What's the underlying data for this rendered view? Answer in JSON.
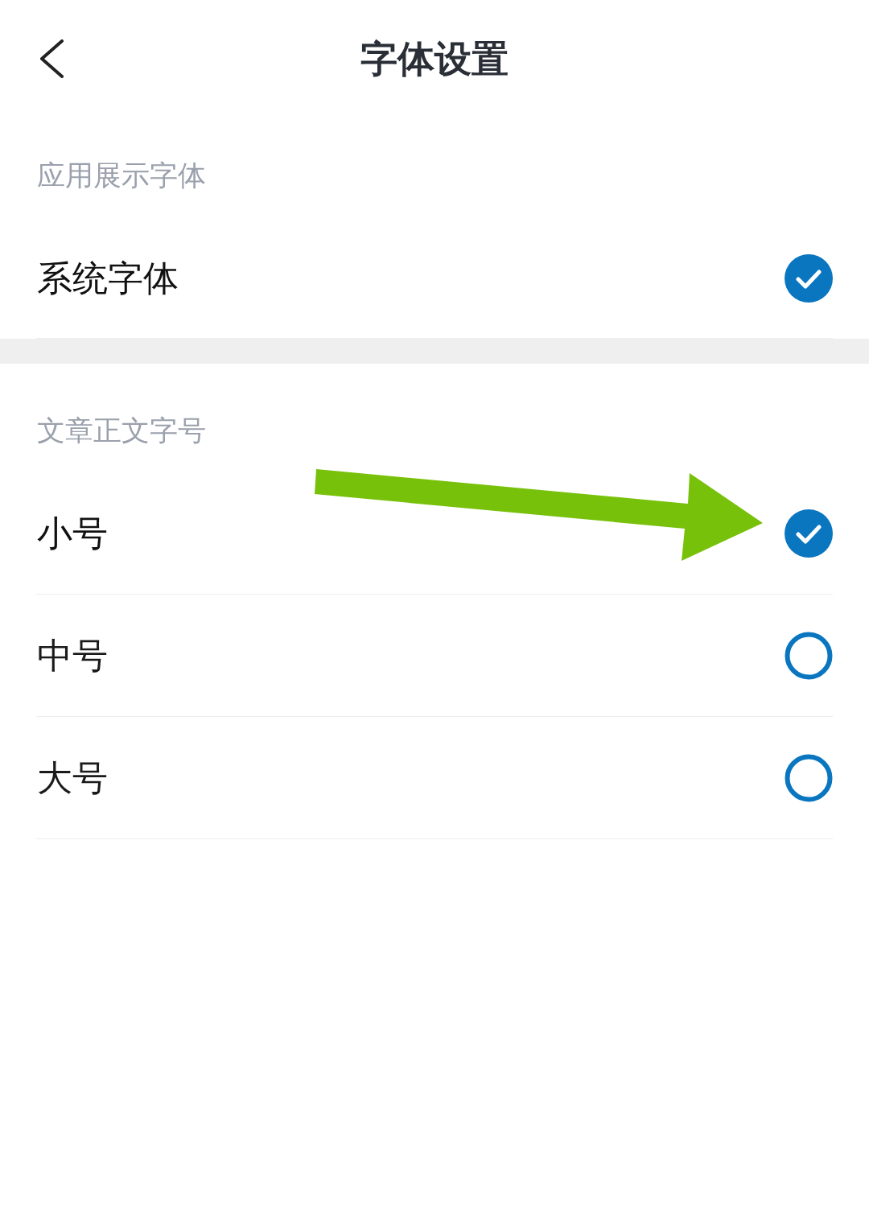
{
  "header": {
    "title": "字体设置"
  },
  "sections": [
    {
      "label": "应用展示字体",
      "options": [
        {
          "label": "系统字体",
          "selected": true
        }
      ]
    },
    {
      "label": "文章正文字号",
      "options": [
        {
          "label": "小号",
          "selected": true
        },
        {
          "label": "中号",
          "selected": false
        },
        {
          "label": "大号",
          "selected": false
        }
      ]
    }
  ]
}
